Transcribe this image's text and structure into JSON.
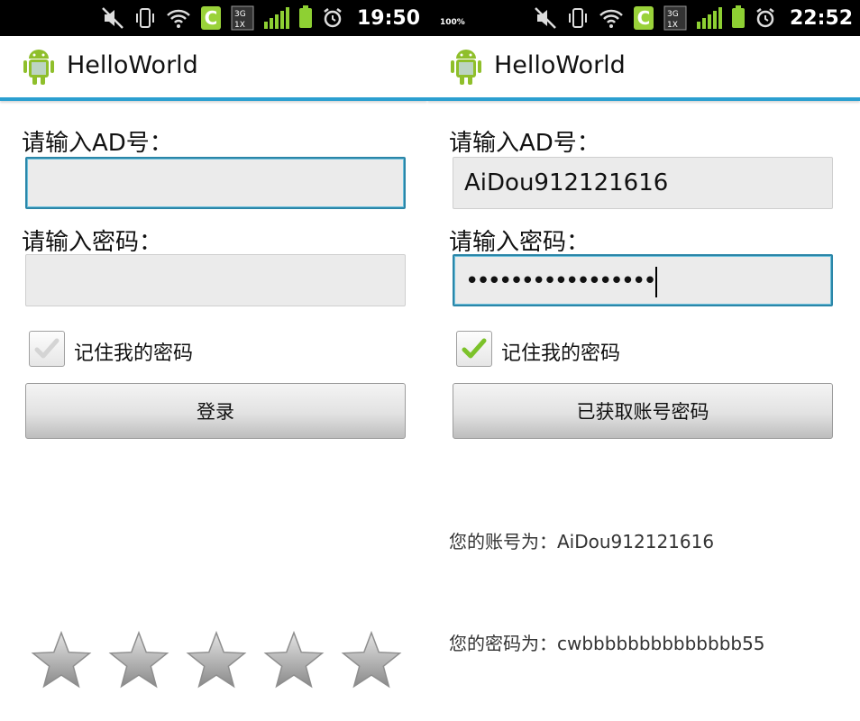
{
  "screens": [
    {
      "status": {
        "time": "19:50",
        "network": "3G",
        "battery_label": ""
      },
      "app_title": "HelloWorld",
      "ad_label": "请输入AD号：",
      "ad_value": "",
      "pwd_label": "请输入密码：",
      "pwd_value": "",
      "remember_label": "记住我的密码",
      "remember_checked": false,
      "button_label": "登录",
      "rating": {
        "max": 5,
        "value": 0
      }
    },
    {
      "status": {
        "time": "22:52",
        "network": "3G",
        "battery_label": "100%"
      },
      "app_title": "HelloWorld",
      "ad_label": "请输入AD号：",
      "ad_value": "AiDou912121616",
      "pwd_label": "请输入密码：",
      "pwd_value": "•••••••••••••••••",
      "remember_label": "记住我的密码",
      "remember_checked": true,
      "button_label": "已获取账号密码",
      "account_info": "您的账号为：AiDou912121616",
      "password_info": "您的密码为：cwbbbbbbbbbbbbbb55"
    }
  ],
  "colors": {
    "accent": "#2a9fd0",
    "status_green": "#8ed033",
    "check_green": "#7cc22a"
  }
}
